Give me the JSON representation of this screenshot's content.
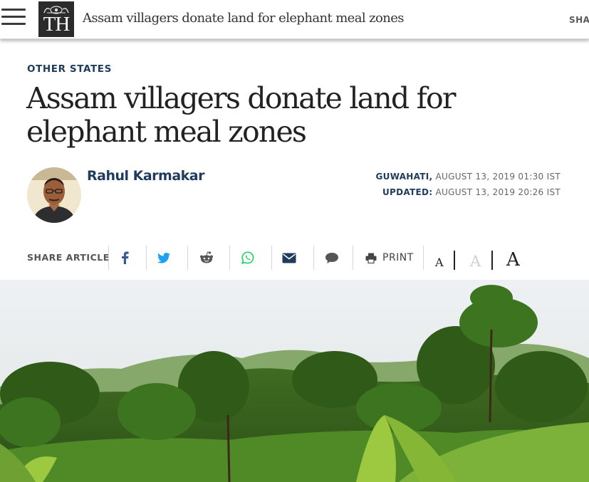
{
  "topbar": {
    "logo_text": "TH",
    "title": "Assam villagers donate land for elephant meal zones",
    "share_label": "SHA"
  },
  "article": {
    "section": "OTHER STATES",
    "headline": "Assam villagers donate land for elephant meal zones",
    "author": "Rahul Karmakar",
    "dateline": {
      "place": "GUWAHATI,",
      "published": "AUGUST 13, 2019 01:30 IST",
      "updated_label": "UPDATED:",
      "updated": "AUGUST 13, 2019 20:26 IST"
    }
  },
  "share_bar": {
    "label": "SHARE ARTICLE",
    "icons": [
      "facebook-icon",
      "twitter-icon",
      "reddit-icon",
      "whatsapp-icon",
      "email-icon",
      "comment-icon",
      "print-icon"
    ],
    "print_label": "PRINT",
    "font_sizes": [
      "A",
      "A",
      "A"
    ]
  },
  "colors": {
    "accent_navy": "#1f3c5e",
    "facebook": "#3b5998",
    "twitter": "#1da1f2",
    "whatsapp": "#25d366",
    "email": "#1f3c5e"
  }
}
